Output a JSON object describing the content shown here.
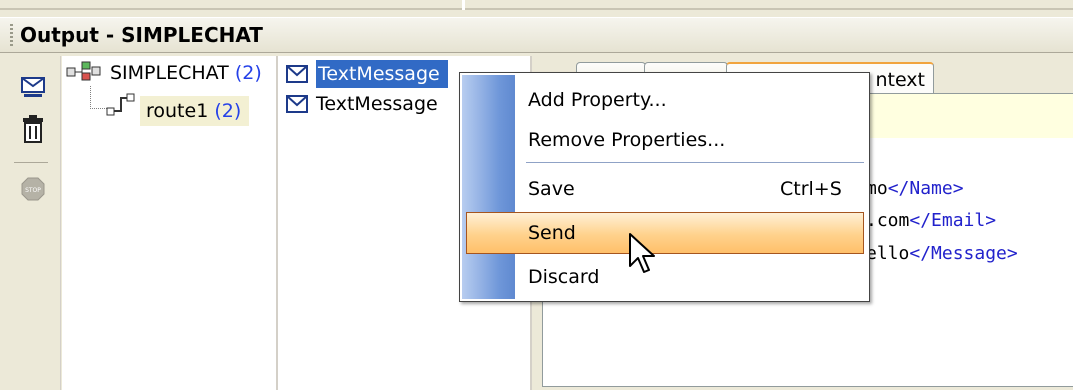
{
  "output": {
    "title": "Output - SIMPLECHAT"
  },
  "toolbar": {
    "send_icon": "send-mail-icon",
    "delete_icon": "trash-icon",
    "stop_icon": "stop-icon"
  },
  "tree": {
    "root": {
      "label": "SIMPLECHAT",
      "count": "(2)"
    },
    "child": {
      "label": "route1",
      "count": "(2)"
    }
  },
  "messages": [
    {
      "label": "TextMessage",
      "selected": true
    },
    {
      "label": "TextMessage",
      "selected": false
    }
  ],
  "detail": {
    "tab_label": "ntext",
    "xml_lines": [
      {
        "text": "mo",
        "tag": "</Name>"
      },
      {
        "text": ".com",
        "tag": "</Email>"
      },
      {
        "text": "ello",
        "tag": "</Message>"
      }
    ]
  },
  "context_menu": {
    "items": [
      {
        "label": "Add Property..."
      },
      {
        "label": "Remove Properties..."
      },
      {
        "label": "Save",
        "shortcut": "Ctrl+S"
      },
      {
        "label": "Send",
        "highlighted": true
      },
      {
        "label": "Discard"
      }
    ]
  },
  "colors": {
    "selection": "#316ac5",
    "count": "#2541e8",
    "menu_highlight": "#ffd28c",
    "xml_tag": "#2222cc"
  }
}
